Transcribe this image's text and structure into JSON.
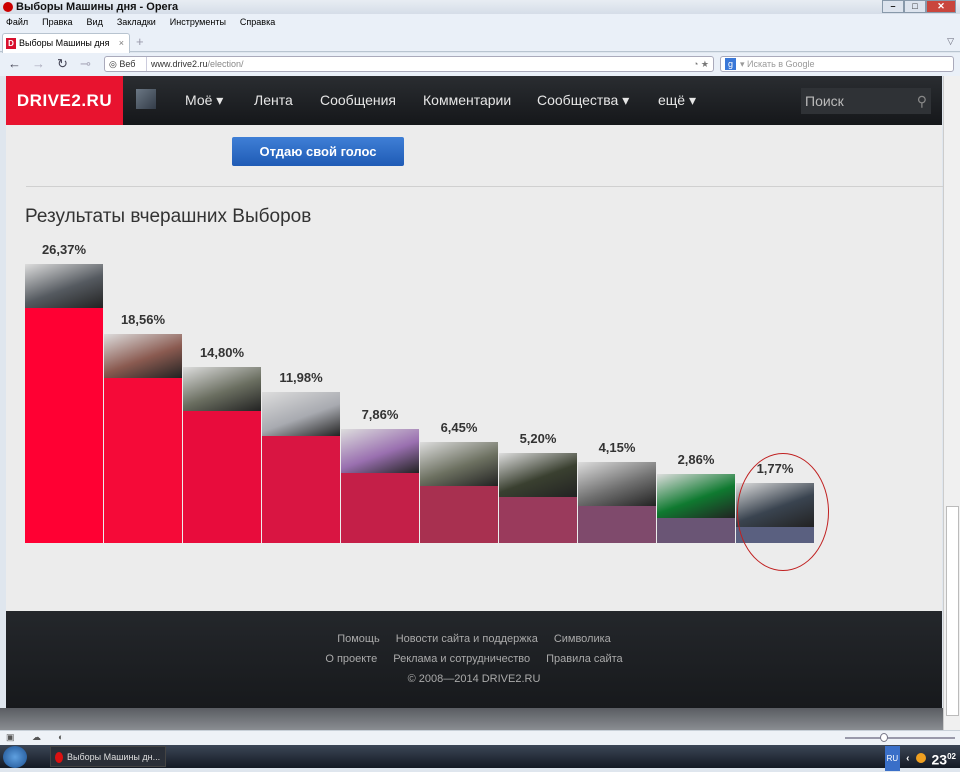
{
  "window": {
    "title": "Выборы Машины дня - Opera"
  },
  "menu": [
    "Файл",
    "Правка",
    "Вид",
    "Закладки",
    "Инструменты",
    "Справка"
  ],
  "tab": {
    "label": "Выборы Машины дня",
    "favicon": "D"
  },
  "address": {
    "web_label": "Веб",
    "url_domain": "www.drive2.ru",
    "url_path": "/election/"
  },
  "google": {
    "placeholder": "Искать в Google"
  },
  "site": {
    "logo": "DRIVE2.RU",
    "nav": [
      "Моё",
      "Лента",
      "Сообщения",
      "Комментарии",
      "Сообщества",
      "ещё"
    ],
    "search_placeholder": "Поиск",
    "vote_button": "Отдаю свой голос",
    "results_title": "Результаты вчерашних Выборов"
  },
  "chart_data": {
    "type": "bar",
    "title": "Результаты вчерашних Выборов",
    "labels": [
      "26,37%",
      "18,56%",
      "14,80%",
      "11,98%",
      "7,86%",
      "6,45%",
      "5,20%",
      "4,15%",
      "2,86%",
      "1,77%"
    ],
    "values": [
      26.37,
      18.56,
      14.8,
      11.98,
      7.86,
      6.45,
      5.2,
      4.15,
      2.86,
      1.77
    ],
    "colors": [
      "#ff0033",
      "#f50a38",
      "#e80c3c",
      "#d91542",
      "#c41f48",
      "#a83050",
      "#9a3a5c",
      "#7f4a6c",
      "#6a5575",
      "#5a6080"
    ],
    "image_tints": [
      "#555a60",
      "#8a5a50",
      "#6a6e60",
      "#a8aab0",
      "#9a70b0",
      "#6c7060",
      "#3a4030",
      "#707070",
      "#0f7a30",
      "#3a4450"
    ]
  },
  "footer": {
    "row1": [
      "Помощь",
      "Новости сайта и поддержка",
      "Символика"
    ],
    "row2": [
      "О проекте",
      "Реклама и сотрудничество",
      "Правила сайта"
    ],
    "copyright": "© 2008—2014 DRIVE2.RU"
  },
  "taskbar": {
    "item": "Выборы Машины дн...",
    "lang": "RU",
    "time": "23",
    "time_small": "02"
  }
}
